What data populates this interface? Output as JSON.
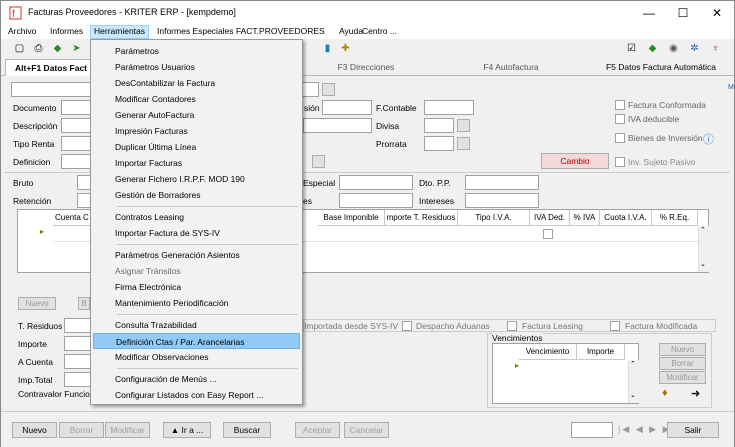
{
  "window": {
    "title": "Facturas Proveedores  -  KRITER ERP  -  [kempdemo]",
    "minimize": "—",
    "maximize": "☐",
    "close": "✕"
  },
  "menubar": [
    "Archivo",
    "Informes",
    "Herramientas",
    "Informes Especiales FACT.PROVEEDORES",
    "Ayuda",
    "Centro ..."
  ],
  "tabs": [
    "Alt+F1 Datos Fact",
    "F3 Direcciones",
    "F4 Autofactura",
    "F5 Datos Factura Automática"
  ],
  "form": {
    "documento": "Documento",
    "descripcion": "Descripción",
    "tipo_renta": "Tipo Renta",
    "definicion": "Definicion",
    "bruto": "Bruto",
    "retencion": "Retención",
    "fecha_emision": "sión",
    "fcontable": "F.Contable",
    "divisa": "Divisa",
    "prorrata": "Prorrata",
    "especial": "Especial",
    "dto_pp": "Dto. P.P.",
    "intereses": "Intereses",
    "es": "es",
    "cambio": "Cambio",
    "mc": "M€"
  },
  "checks": {
    "factura_conformada": "Factura Conformada",
    "iva_deducible": "IVA deducible",
    "bienes_inversion": "Bienes de Inversión",
    "inv_sujeto_pasivo": "Inv. Sujeto Pasivo"
  },
  "grid": {
    "headers": [
      "Cuenta C",
      "Base Imponible",
      "mporte T. Residuos",
      "Tipo I.V.A.",
      "IVA Ded.",
      "% IVA",
      "Cuota I.V.A.",
      "% R.Eq."
    ]
  },
  "grid_buttons": {
    "nuevo": "Nuevo",
    "borrar": "B"
  },
  "flags": {
    "importada": "Importada desde SYS-IV",
    "despacho": "Despacho Aduanas",
    "leasing": "Factura Leasing",
    "modificada": "Factura Modificada"
  },
  "totals": {
    "t_residuos": "T. Residuos",
    "importe": "Importe",
    "a_cuenta": "A Cuenta",
    "imp_total": "Imp.Total",
    "contravalor": "Contravalor Funcion"
  },
  "vencimientos": {
    "title": "Vencimientos",
    "col_venc": "Vencimiento",
    "col_imp": "Importe",
    "nuevo": "Nuevo",
    "borrar": "Borrar",
    "modificar": "Modificar"
  },
  "bottom": {
    "nuevo": "Nuevo",
    "borrar": "Borrar",
    "modificar": "Modificar",
    "ira": "▲ Ir a ...",
    "buscar": "Buscar",
    "aceptar": "Aceptar",
    "cancelar": "Cancelar",
    "salir": "Salir"
  },
  "herramientas_menu": [
    {
      "label": "Parámetros",
      "enabled": true
    },
    {
      "label": "Parámetros Usuarios",
      "enabled": true
    },
    {
      "label": "DesContabilizar la Factura",
      "enabled": true
    },
    {
      "label": "Modificar Contadores",
      "enabled": true
    },
    {
      "label": "Generar AutoFactura",
      "enabled": true
    },
    {
      "label": "Impresión Facturas",
      "enabled": true
    },
    {
      "label": "Duplicar Última Línea",
      "enabled": true
    },
    {
      "label": "Importar Facturas",
      "enabled": true
    },
    {
      "label": "Generar Fichero I.R.P.F. MOD 190",
      "enabled": true
    },
    {
      "label": "Gestión de Borradores",
      "enabled": true
    },
    {
      "label": "Contratos Leasing",
      "enabled": true
    },
    {
      "label": "Importar Factura de SYS-IV",
      "enabled": true
    },
    {
      "label": "Parámetros Generación Asientos",
      "enabled": true
    },
    {
      "label": "Asignar Tránsitos",
      "enabled": false
    },
    {
      "label": "Firma Electrónica",
      "enabled": true
    },
    {
      "label": "Mantenimiento Periodificación",
      "enabled": true
    },
    {
      "label": "Consulta Trazabilidad",
      "enabled": true
    },
    {
      "label": "Definición Ctas / Par. Arancelarias",
      "enabled": true,
      "selected": true
    },
    {
      "label": "Modificar Observaciones",
      "enabled": true
    },
    {
      "label": "Configuración de Menús ...",
      "enabled": true
    },
    {
      "label": "Configurar Listados con Easy Report ...",
      "enabled": true
    }
  ]
}
